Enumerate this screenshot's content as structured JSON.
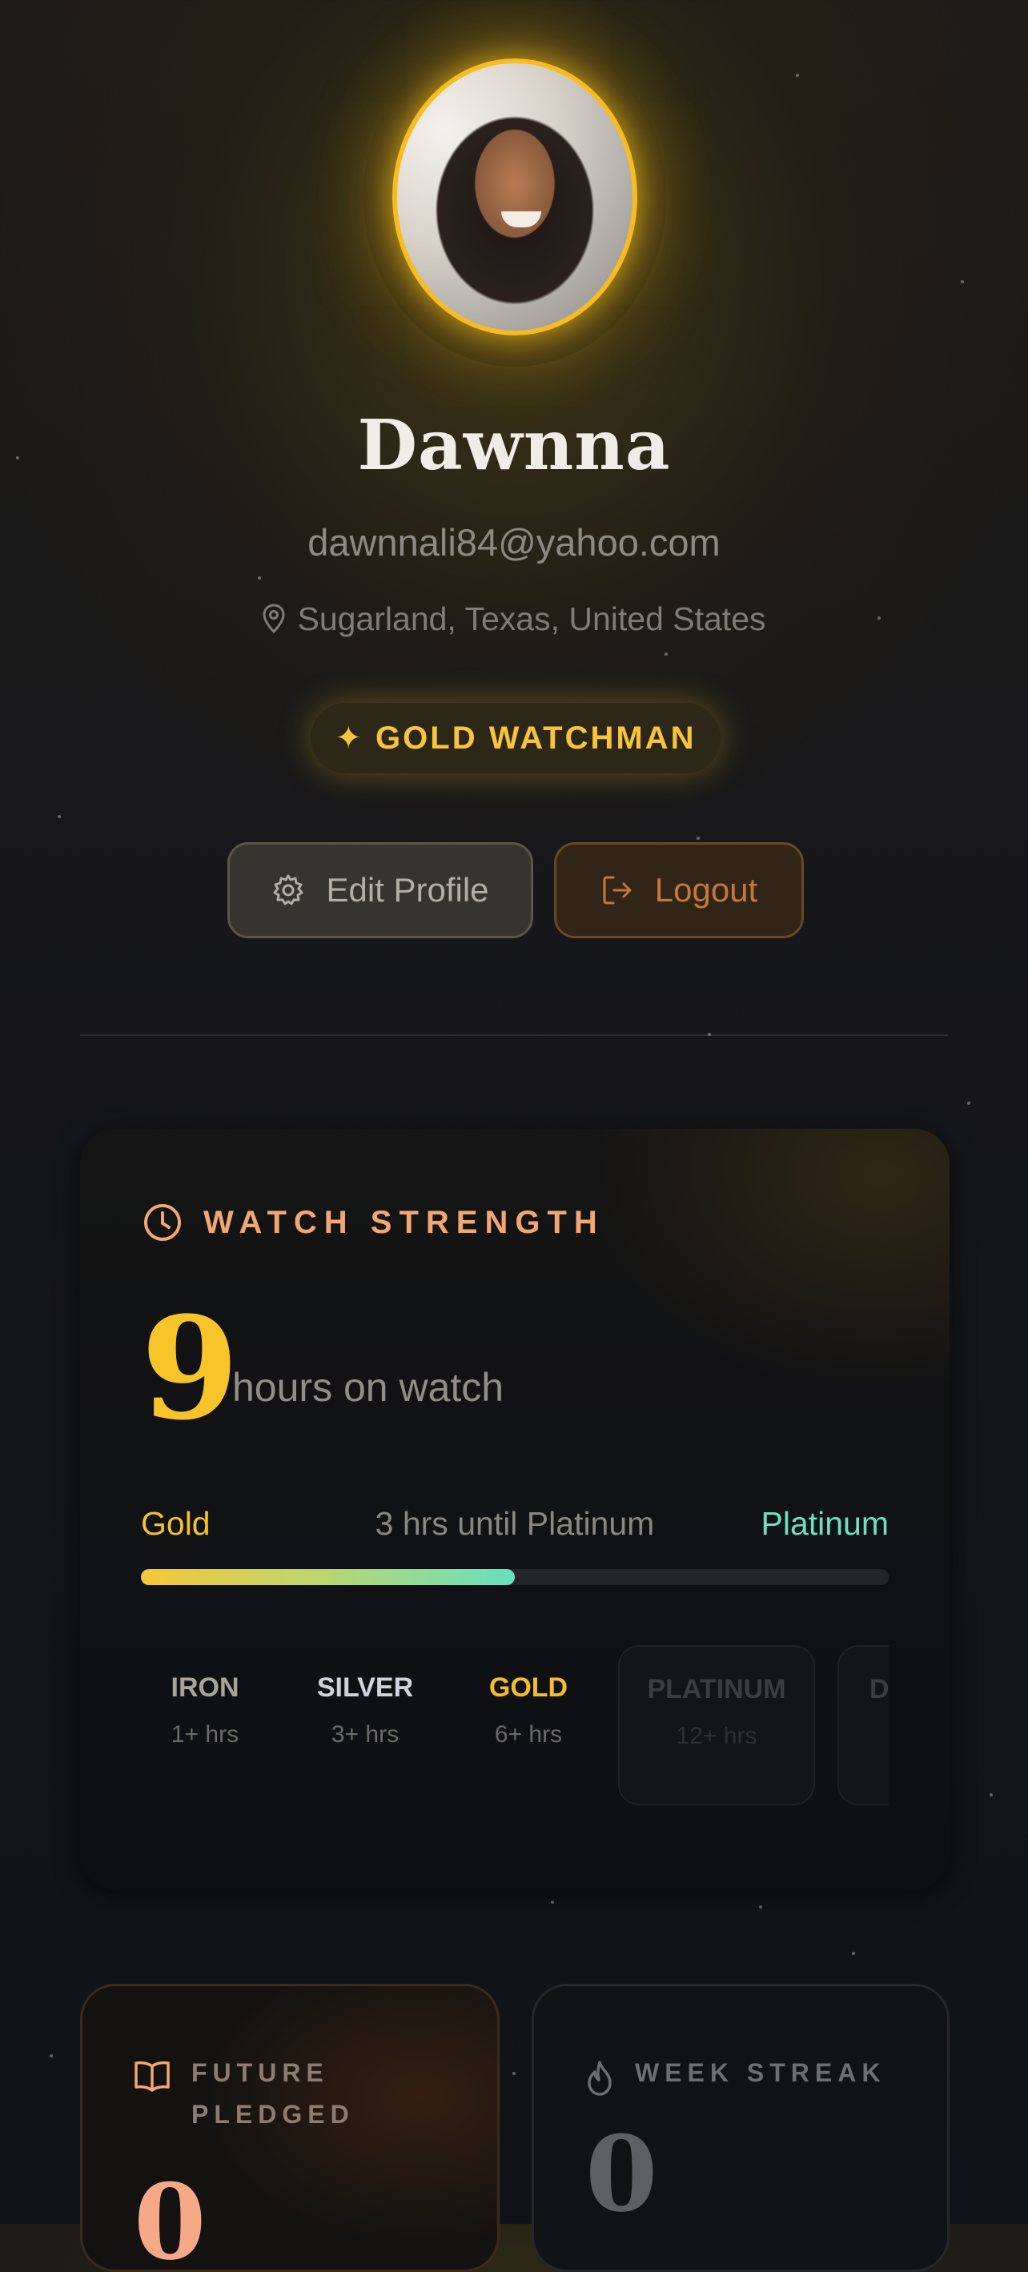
{
  "profile": {
    "name": "Dawnna",
    "email": "dawnnali84@yahoo.com",
    "location": "Sugarland, Texas, United States",
    "badge_icon": "sparkle-icon",
    "badge": "GOLD WATCHMAN"
  },
  "actions": {
    "edit_label": "Edit Profile",
    "edit_icon": "gear-icon",
    "logout_label": "Logout",
    "logout_icon": "logout-icon"
  },
  "watch_strength": {
    "title": "WATCH STRENGTH",
    "icon": "clock-icon",
    "hours": "9",
    "hours_label": "hours on watch",
    "current_tier": "Gold",
    "next_tier": "Platinum",
    "until_text": "3 hrs until Platinum",
    "progress_fraction": 0.5,
    "tiers": [
      {
        "name": "IRON",
        "hours": "1+ hrs"
      },
      {
        "name": "SILVER",
        "hours": "3+ hrs"
      },
      {
        "name": "GOLD",
        "hours": "6+ hrs"
      },
      {
        "name": "PLATINUM",
        "hours": "12+ hrs"
      },
      {
        "name": "D",
        "hours": ""
      }
    ]
  },
  "stats": {
    "future_pledged": {
      "label_line1": "FUTURE",
      "label_line2": "PLEDGED",
      "value": "0",
      "icon": "book-icon"
    },
    "week_streak": {
      "label": "WEEK STREAK",
      "value": "0",
      "icon": "flame-icon"
    }
  },
  "colors": {
    "gold": "#f7bd20",
    "platinum": "#6fe0bd",
    "accent_orange": "#f2a673",
    "logout": "#c6773c"
  }
}
